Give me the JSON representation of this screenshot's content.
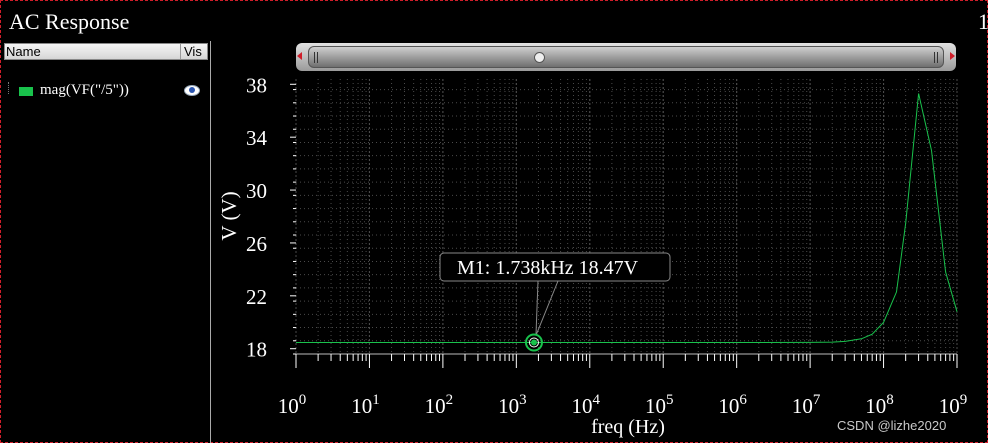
{
  "window": {
    "title": "AC Response",
    "number": "1"
  },
  "legend": {
    "col_name": "Name",
    "col_vis": "Vis",
    "items": [
      {
        "label": "mag(VF(\"/5\"))",
        "color": "#19c24c"
      }
    ]
  },
  "chart_data": {
    "type": "line",
    "title": "",
    "xlabel": "freq (Hz)",
    "ylabel": "V (V)",
    "xscale": "log",
    "xlim": [
      1,
      1000000000
    ],
    "ylim": [
      17.6,
      38.4
    ],
    "xtick_exponents": [
      0,
      1,
      2,
      3,
      4,
      5,
      6,
      7,
      8,
      9
    ],
    "yticks": [
      18,
      22,
      26,
      30,
      34,
      38
    ],
    "grid": true,
    "background": "#000000",
    "grid_color": "#4a4a4a",
    "series": [
      {
        "color": "#19c24c",
        "x": [
          1,
          10,
          100,
          1000,
          10000,
          100000,
          1000000,
          10000000,
          20000000,
          30000000,
          50000000,
          70000000,
          100000000,
          150000000,
          200000000,
          300000000,
          450000000,
          700000000,
          1000000000
        ],
        "y": [
          18.47,
          18.47,
          18.47,
          18.47,
          18.47,
          18.47,
          18.47,
          18.48,
          18.5,
          18.55,
          18.75,
          19.1,
          20.0,
          22.3,
          27.5,
          37.3,
          33.0,
          23.8,
          20.8
        ]
      }
    ],
    "marker": {
      "name": "M1",
      "x": 1738,
      "y": 18.47,
      "label": "M1: 1.738kHz 18.47V"
    }
  },
  "watermark": "CSDN @lizhe2020"
}
